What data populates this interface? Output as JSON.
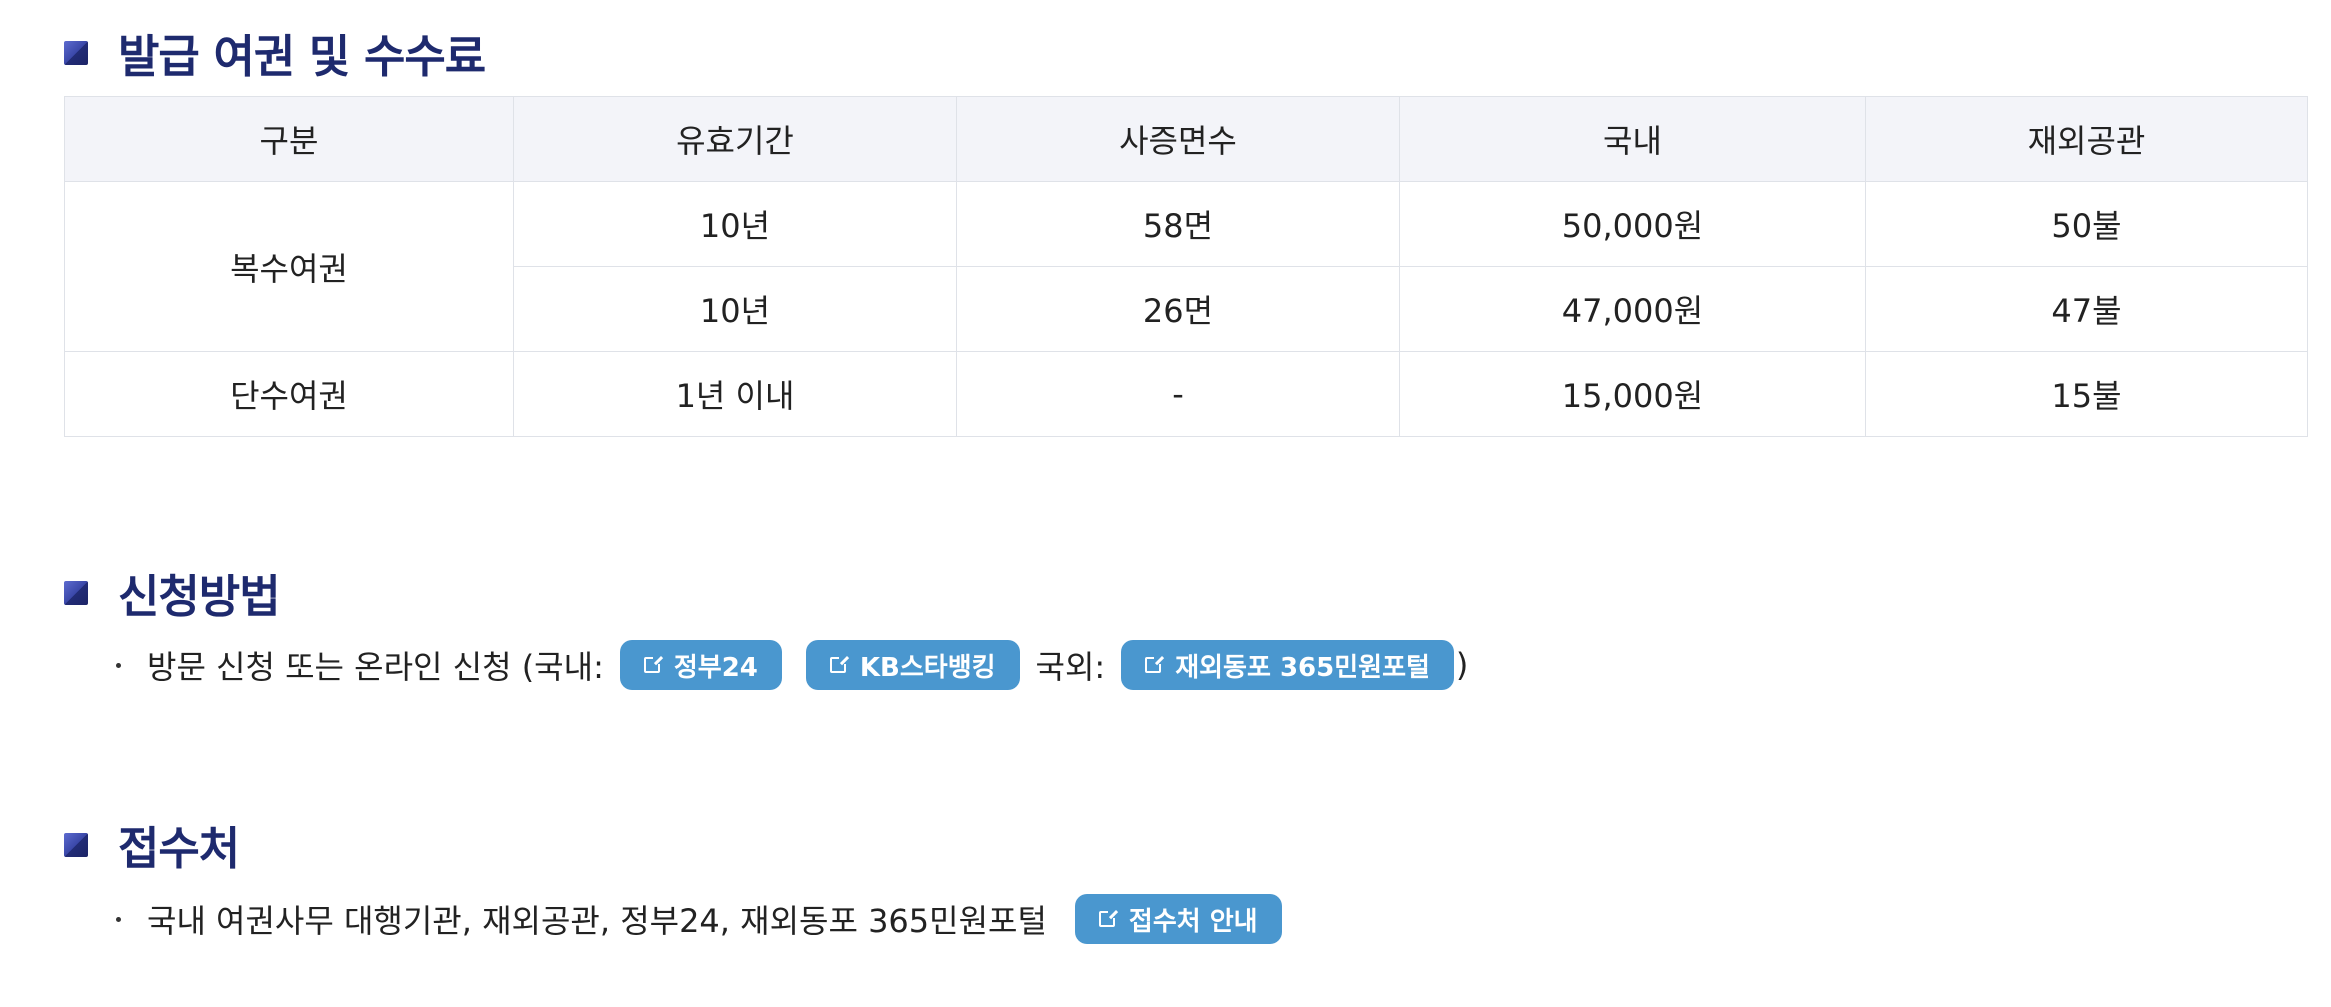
{
  "sections": {
    "fees": {
      "title": "발급 여권 및 수수료"
    },
    "apply": {
      "title": "신청방법"
    },
    "reception": {
      "title": "접수처"
    }
  },
  "table": {
    "headers": [
      "구분",
      "유효기간",
      "사증면수",
      "국내",
      "재외공관"
    ],
    "rows": [
      {
        "type": "복수여권",
        "period": "10년",
        "pages": "58면",
        "domestic": "50,000원",
        "abroad": "50불"
      },
      {
        "type": "복수여권",
        "period": "10년",
        "pages": "26면",
        "domestic": "47,000원",
        "abroad": "47불"
      },
      {
        "type": "단수여권",
        "period": "1년 이내",
        "pages": "-",
        "domestic": "15,000원",
        "abroad": "15불"
      }
    ]
  },
  "apply_line": {
    "text_before": "방문 신청 또는 온라인 신청 (국내:",
    "link_gov24": "정부24",
    "link_kb": "KB스타뱅킹",
    "text_abroad": "국외:",
    "link_portal": "재외동포 365민원포털",
    "text_after": ")"
  },
  "reception_line": {
    "text": "국내 여권사무 대행기관, 재외공관, 정부24, 재외동포 365민원포털",
    "link_guide": "접수처 안내"
  },
  "colors": {
    "title": "#1e2a6e",
    "button": "#4a97cf",
    "header_bg": "#f3f4f9",
    "border": "#dfe2e8"
  },
  "icons": [
    "section-square-icon",
    "external-link-icon"
  ]
}
